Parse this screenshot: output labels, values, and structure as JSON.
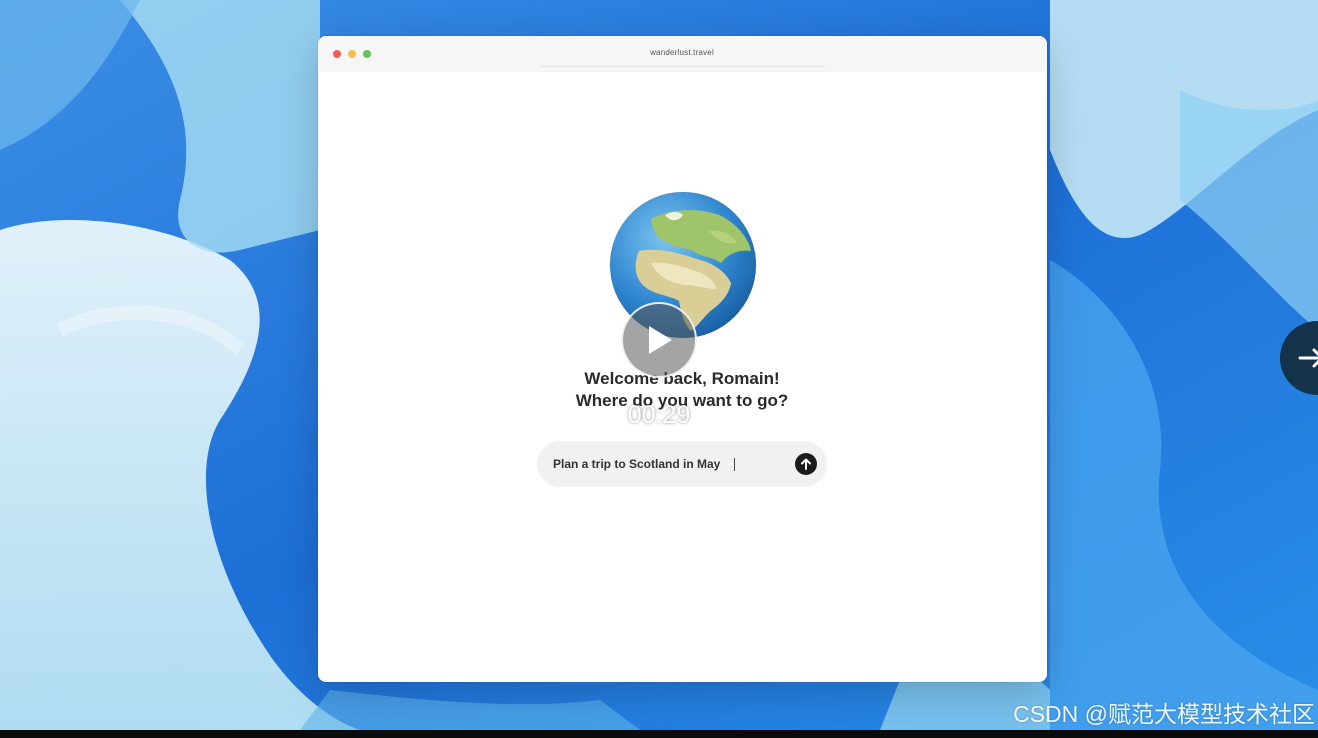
{
  "browser": {
    "url": "wanderlust.travel"
  },
  "app": {
    "welcome_line1": "Welcome back, Romain!",
    "welcome_line2": "Where do you want to go?",
    "prompt_value": "Plan a trip to Scotland in May",
    "send_icon": "arrow-up-icon",
    "globe_icon": "earth-globe-icon"
  },
  "video": {
    "timestamp": "00:29",
    "play_icon": "play-icon",
    "next_icon": "arrow-right-icon"
  },
  "watermark": "CSDN @赋范大模型技术社区",
  "colors": {
    "wallpaper_blue": "#1f6fd1",
    "send_button": "#1c1c1c",
    "side_button": "#14324a"
  }
}
